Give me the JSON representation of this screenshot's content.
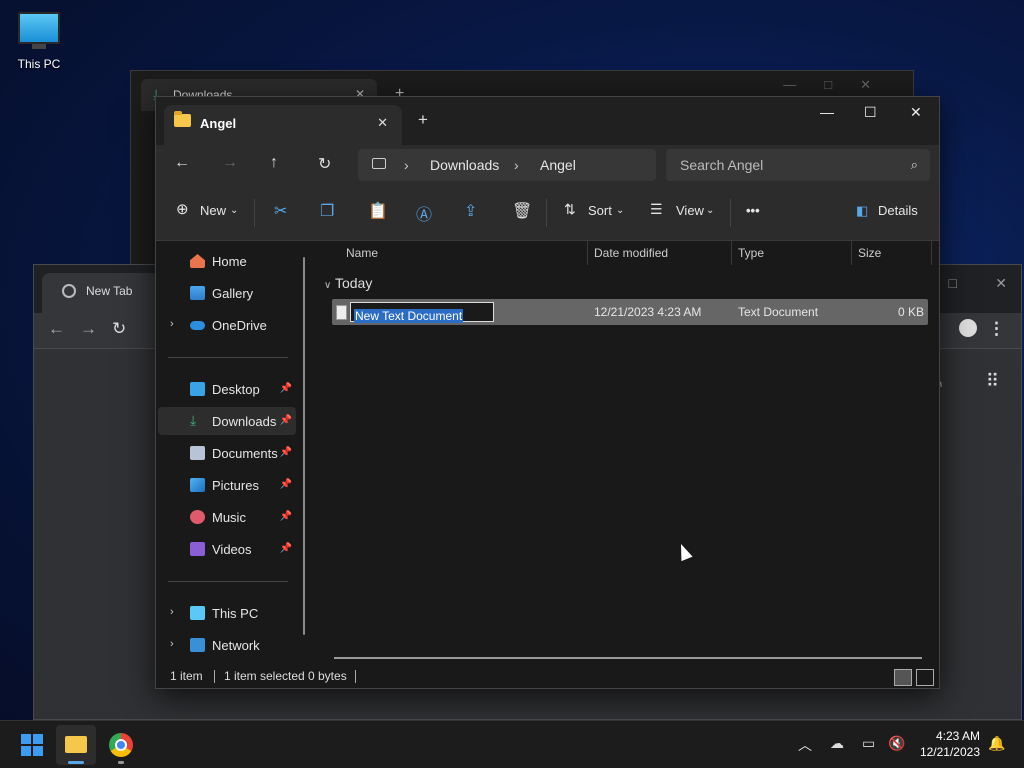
{
  "desktop": {
    "this_pc_label": "This PC"
  },
  "back_window": {
    "tab_title": "Downloads",
    "close": "✕",
    "new_tab": "+"
  },
  "chrome": {
    "tab_title": "New Tab"
  },
  "explorer": {
    "tab_title": "Angel",
    "breadcrumb": [
      "Downloads",
      "Angel"
    ],
    "search_placeholder": "Search Angel",
    "commands": {
      "new": "New",
      "sort": "Sort",
      "view": "View",
      "more": "•••",
      "details": "Details"
    },
    "nav": {
      "home": "Home",
      "gallery": "Gallery",
      "onedrive": "OneDrive",
      "desktop": "Desktop",
      "downloads": "Downloads",
      "documents": "Documents",
      "pictures": "Pictures",
      "music": "Music",
      "videos": "Videos",
      "this_pc": "This PC",
      "network": "Network"
    },
    "columns": {
      "name": "Name",
      "date": "Date modified",
      "type": "Type",
      "size": "Size"
    },
    "group": "Today",
    "file": {
      "name": "New Text Document",
      "date": "12/21/2023 4:23 AM",
      "type": "Text Document",
      "size": "0 KB"
    },
    "status": {
      "count": "1 item",
      "selected": "1 item selected",
      "bytes": "0 bytes"
    }
  },
  "taskbar": {
    "time": "4:23 AM",
    "date": "12/21/2023"
  },
  "colors": {
    "accent": "#3b9cf1",
    "folder": "#f5c84c",
    "selection": "#2b6cc4"
  }
}
